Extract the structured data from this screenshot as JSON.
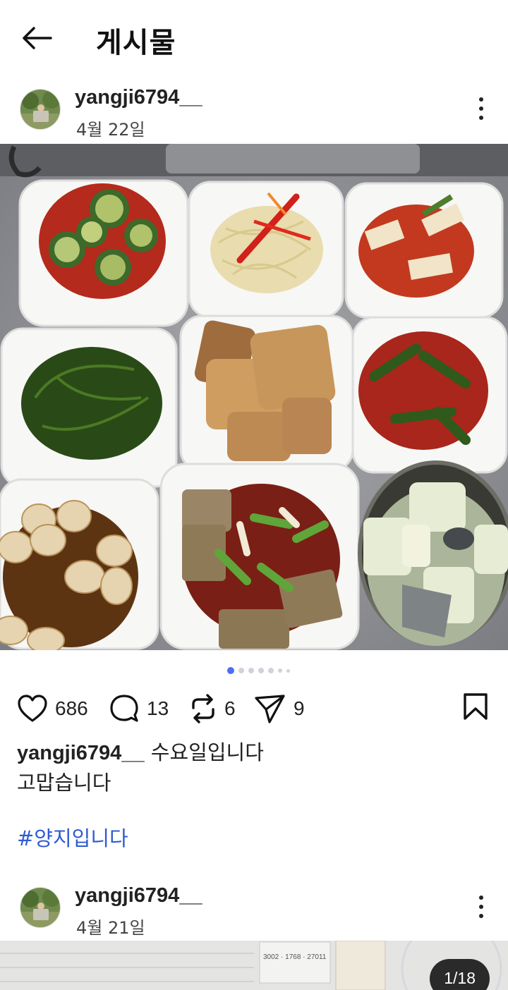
{
  "header": {
    "title": "게시물"
  },
  "post": {
    "username": "yangji6794__",
    "date": "4월 22일",
    "carousel": {
      "total": 7,
      "active": 1
    },
    "stats": {
      "likes": "686",
      "comments": "13",
      "reposts": "6",
      "shares": "9"
    },
    "caption": {
      "username": "yangji6794__",
      "line1": " 수요일입니다",
      "line2": "고맙습니다"
    },
    "hashtag": "#양지입니다"
  },
  "next_post": {
    "username": "yangji6794__",
    "date": "4월 21일",
    "image_counter": "1/18",
    "sign_phone": "3002 · 1768 · 27011"
  },
  "icons": {
    "back": "arrow-left-icon",
    "more": "more-vertical-icon",
    "like": "heart-icon",
    "comment": "comment-icon",
    "repost": "repost-icon",
    "share": "send-icon",
    "save": "bookmark-icon"
  },
  "colors": {
    "link": "#2f5bd3",
    "carousel_active": "#4c6ef5"
  }
}
